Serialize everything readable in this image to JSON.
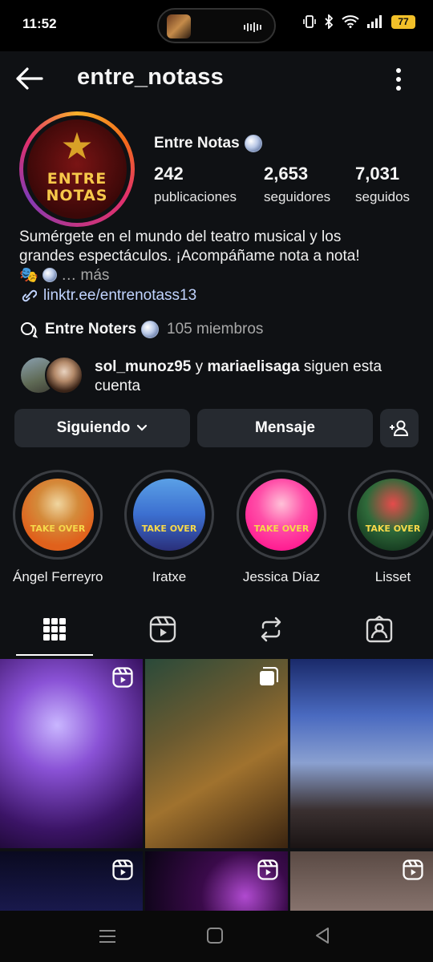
{
  "status_bar": {
    "time": "11:52",
    "battery": "77"
  },
  "header": {
    "username": "entre_notass"
  },
  "profile": {
    "display_name": "Entre Notas",
    "logo_lines": [
      "ENTRE",
      "NOTAS"
    ],
    "stats": [
      {
        "value": "242",
        "label": "publicaciones"
      },
      {
        "value": "2,653",
        "label": "seguidores"
      },
      {
        "value": "7,031",
        "label": "seguidos"
      }
    ],
    "bio_line1": "Sumérgete en el mundo del teatro musical y los",
    "bio_line2": "grandes espectáculos. ¡Acompáñame nota a nota!",
    "bio_more": "… más",
    "link": "linktr.ee/entrenotass13"
  },
  "community": {
    "name": "Entre Noters",
    "members": "105 miembros"
  },
  "mutual": {
    "user1": "sol_munoz95",
    "conj": " y ",
    "user2": "mariaelisaga",
    "rest": " siguen esta cuenta"
  },
  "buttons": {
    "following": "Siguiendo",
    "message": "Mensaje"
  },
  "highlights": [
    {
      "name": "Ángel Ferreyro",
      "tag": "TAKE OVER",
      "bg": "#e0611c"
    },
    {
      "name": "Iratxe",
      "tag": "TAKE OVER",
      "bg": "#3c6fd0"
    },
    {
      "name": "Jessica Díaz",
      "tag": "TAKE OVER",
      "bg": "#ff2a9e"
    },
    {
      "name": "Lisset",
      "tag": "TAKE OVER",
      "bg": "#1f5e2c"
    }
  ],
  "colors": {
    "background": "#0f1114",
    "button_bg": "#262a30",
    "link": "#c1d4ff",
    "secondary_text": "#a8a8a8"
  }
}
